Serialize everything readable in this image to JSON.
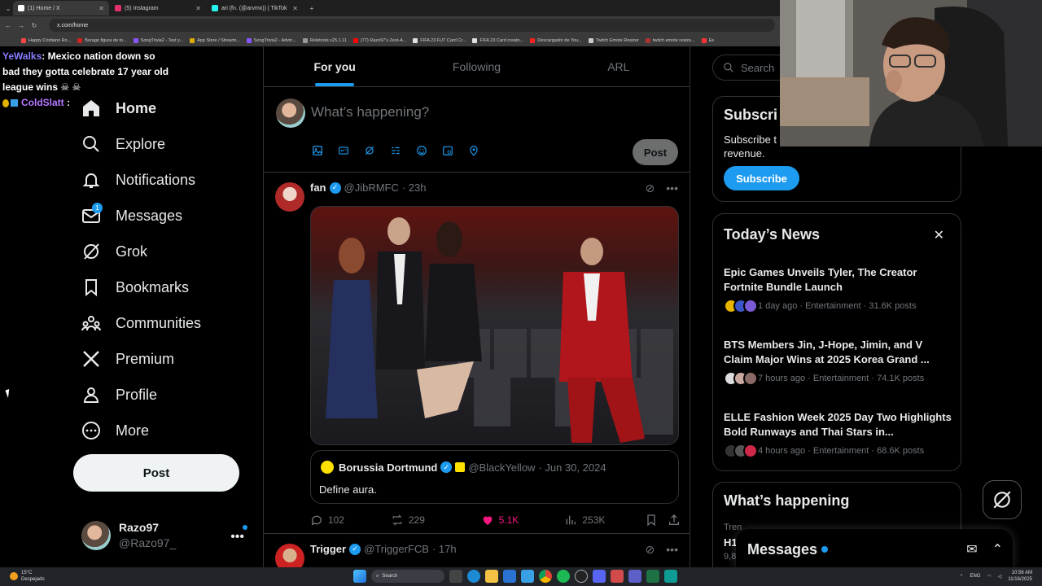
{
  "browser": {
    "tabs": [
      {
        "label": "(1) Home / X",
        "color": "#ffffff"
      },
      {
        "label": "(5) Instagram",
        "color": "#e1306c"
      },
      {
        "label": "ari (fn. (@arvmx)) | TikTok",
        "color": "#25f4ee"
      }
    ],
    "new_tab": "+",
    "url": "x.com/home",
    "bookmarks": [
      {
        "label": "Happy Cristiano Ro...",
        "color": "#ff4444"
      },
      {
        "label": "Burago figura de to...",
        "color": "#cc2222"
      },
      {
        "label": "SongTrivia2 - Test y...",
        "color": "#8855ff"
      },
      {
        "label": "App Store / Streami...",
        "color": "#ddaa00"
      },
      {
        "label": "SongTrivia2 - Advin...",
        "color": "#8855ff"
      },
      {
        "label": "Reletools v25.1.11",
        "color": "#999999"
      },
      {
        "label": "(77) Razo97's Zest-A...",
        "color": "#ff0000"
      },
      {
        "label": "FIFA 23 FUT Card Cr...",
        "color": "#e0e0e0"
      },
      {
        "label": "FIFA 23 Card creato...",
        "color": "#e0e0e0"
      },
      {
        "label": "Descargador de You...",
        "color": "#ff2222"
      },
      {
        "label": "Twitch Emote Resizer",
        "color": "#cccccc"
      },
      {
        "label": "twitch emote resize...",
        "color": "#aa3333"
      },
      {
        "label": "Es",
        "color": "#ff3333"
      }
    ]
  },
  "chat": {
    "msg1_user": "YeWalks",
    "msg1_text": ": Mexico nation down so bad they gotta celebrate 17 year old league wins ☠ ☠",
    "msg2_user": "ColdSlatt",
    "msg2_text": " :"
  },
  "nav": {
    "home": "Home",
    "explore": "Explore",
    "notifications": "Notifications",
    "messages": "Messages",
    "messages_badge": "1",
    "grok": "Grok",
    "bookmarks": "Bookmarks",
    "communities": "Communities",
    "premium": "Premium",
    "profile": "Profile",
    "more": "More",
    "post": "Post"
  },
  "account": {
    "name": "Razo97",
    "handle": "@Razo97_"
  },
  "feed": {
    "tabs": [
      "For you",
      "Following",
      "ARL"
    ],
    "composer_placeholder": "What’s happening?",
    "composer_post": "Post"
  },
  "tweets": [
    {
      "name": "fan",
      "handle": "@JibRMFC",
      "time": "· 23h",
      "quote": {
        "name": "Borussia Dortmund",
        "handle": "@BlackYellow",
        "time": "· Jun 30, 2024",
        "text": "Define aura.",
        "logo": "BVB"
      },
      "replies": "102",
      "reposts": "229",
      "likes": "5.1K",
      "views": "253K"
    },
    {
      "name": "Trigger",
      "handle": "@TriggerFCB",
      "time": "· 17h"
    }
  ],
  "sidebar": {
    "search_placeholder": "Search",
    "subscribe_title": "Subscri",
    "subscribe_text": "Subscribe t                        eligible, receive a share of revenue.",
    "subscribe_button": "Subscribe",
    "news_title": "Today’s News",
    "news": [
      {
        "title": "Epic Games Unveils Tyler, The Creator Fortnite Bundle Launch",
        "meta": "1 day ago · Entertainment · 31.6K posts"
      },
      {
        "title": "BTS Members Jin, J-Hope, Jimin, and V Claim Major Wins at 2025 Korea Grand ...",
        "meta": "7 hours ago · Entertainment · 74.1K posts"
      },
      {
        "title": "ELLE Fashion Week 2025 Day Two Highlights Bold Runways and Thai Stars in...",
        "meta": "4 hours ago · Entertainment · 68.6K posts"
      }
    ],
    "happening_title": "What’s happening",
    "happening_trend_label": "Tren",
    "happening_trend_title": "H1",
    "happening_trend_count": "9,8"
  },
  "messages_drawer": {
    "title": "Messages"
  },
  "taskbar": {
    "weather_temp": "15°C",
    "weather_desc": "Despejado",
    "search": "Search",
    "lang": "ENG",
    "time": "10:56 AM",
    "date": "11/16/2025"
  },
  "colors": {
    "accent": "#1d9bf0",
    "like": "#f91880",
    "background": "#000000"
  }
}
